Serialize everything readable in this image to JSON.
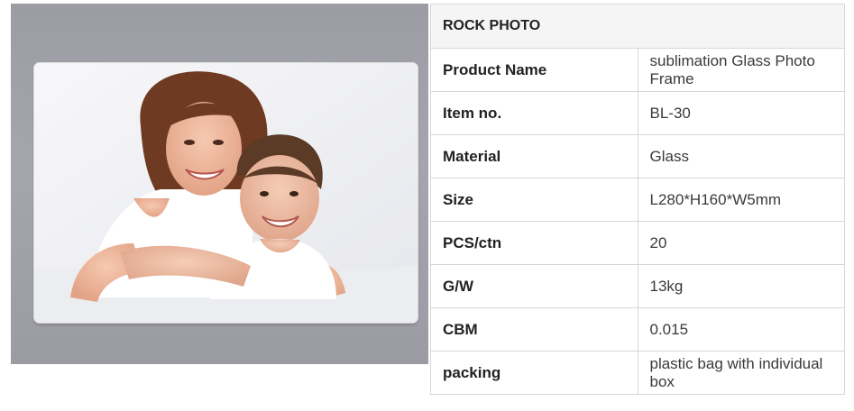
{
  "table": {
    "title": "ROCK PHOTO",
    "rows": [
      {
        "label": "Product Name",
        "value": "sublimation  Glass Photo Frame"
      },
      {
        "label": "Item no.",
        "value": "BL-30"
      },
      {
        "label": "Material",
        "value": "Glass"
      },
      {
        "label": "Size",
        "value": "L280*H160*W5mm"
      },
      {
        "label": "PCS/ctn",
        "value": "20"
      },
      {
        "label": "G/W",
        "value": "13kg"
      },
      {
        "label": "CBM",
        "value": "0.015"
      },
      {
        "label": "packing",
        "value": "plastic bag with individual box"
      }
    ]
  },
  "colors": {
    "background": "#a0a0a8",
    "glass": "#f4f4f4",
    "table_border": "#d6d6d6",
    "header_bg": "#f5f5f5"
  }
}
